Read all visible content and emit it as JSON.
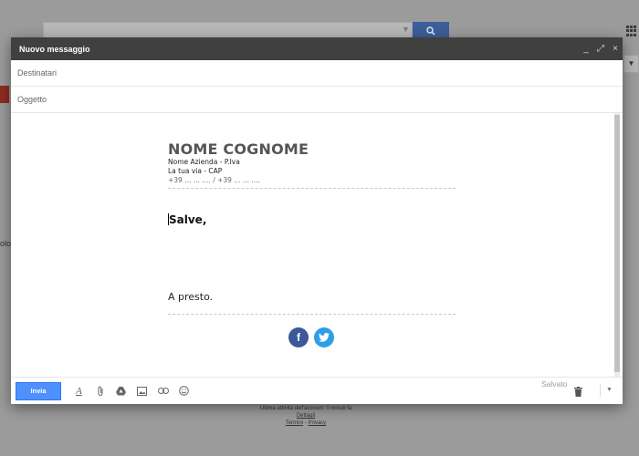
{
  "background": {
    "side_text": "olog",
    "footer": {
      "line1": "Ultima attività dell'account: 0 minuti fa",
      "line2": "Dettagli",
      "line3_a": "Termini",
      "line3_sep": " - ",
      "line3_b": "Privacy"
    }
  },
  "compose": {
    "title": "Nuovo messaggio",
    "controls": {
      "minimize": "_",
      "expand": "⤢",
      "close": "×"
    },
    "to_placeholder": "Destinatari",
    "subject_placeholder": "Oggetto",
    "signature": {
      "name": "NOME COGNOME",
      "company": "Nome Azienda - P.Iva",
      "address": "La tua via - CAP",
      "phones": "+39 ... ... .... / +39 ... ... ...."
    },
    "greeting": "Salve,",
    "closing": "A presto.",
    "social": {
      "facebook": "f",
      "twitter": "t"
    },
    "toolbar": {
      "send_label": "Invia",
      "saved_label": "Salvato"
    }
  },
  "colors": {
    "accent": "#4d90fe",
    "titlebar": "#404040",
    "facebook": "#3b5998",
    "twitter": "#2e9ee6"
  }
}
